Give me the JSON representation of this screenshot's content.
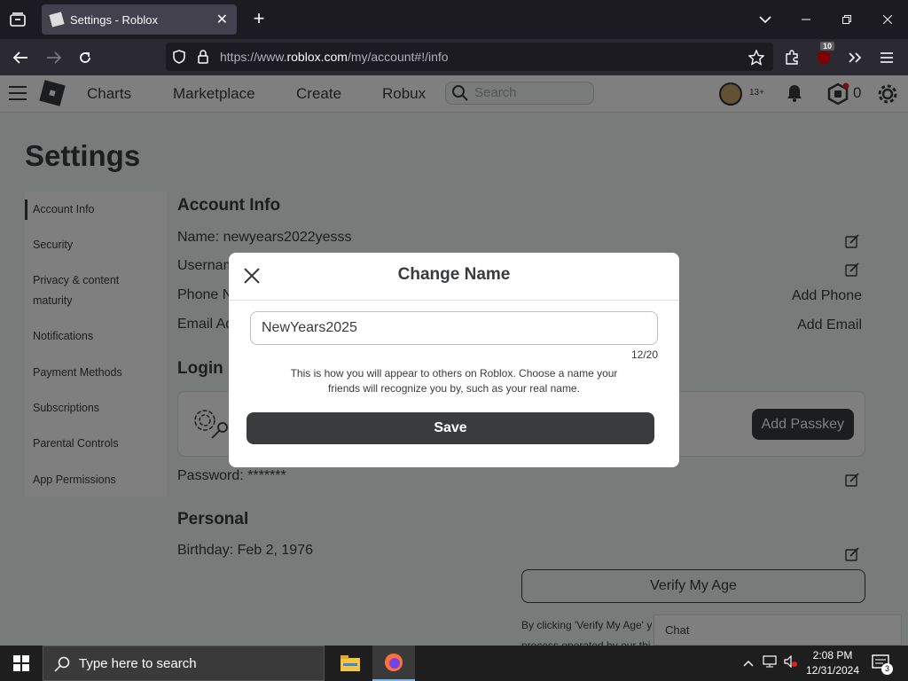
{
  "browser": {
    "tab_title": "Settings - Roblox",
    "url_prefix": "https://www.",
    "url_domain": "roblox.com",
    "url_path": "/my/account#!/info",
    "extension_badge": "10"
  },
  "header": {
    "nav": [
      "Charts",
      "Marketplace",
      "Create",
      "Robux"
    ],
    "search_placeholder": "Search",
    "age_badge": "13+",
    "robux_amount": "0"
  },
  "page": {
    "title": "Settings",
    "sidenav": [
      "Account Info",
      "Security",
      "Privacy & content",
      "maturity",
      "Notifications",
      "Payment Methods",
      "Subscriptions",
      "Parental Controls",
      "App Permissions"
    ],
    "account_info": {
      "title": "Account Info",
      "name_row": "Name: newyears2022yesss",
      "username_row": "Usernam",
      "phone_row": "Phone N",
      "email_row": "Email Ad",
      "add_phone": "Add Phone",
      "add_email": "Add Email"
    },
    "login": {
      "title": "Login",
      "add_passkey": "Add Passkey",
      "password_row": "Password: *******"
    },
    "personal": {
      "title": "Personal",
      "birthday_row": "Birthday:  Feb 2, 1976",
      "verify_button": "Verify My Age",
      "disclaimer_line1": "By clicking 'Verify My Age' y",
      "disclaimer_line2": "process operated by our thi"
    },
    "chat_label": "Chat"
  },
  "modal": {
    "title": "Change Name",
    "input_value": "NewYears2025",
    "char_count": "12/20",
    "description": "This is how you will appear to others on Roblox. Choose a name your friends will recognize you by, such as your real name.",
    "save_label": "Save"
  },
  "taskbar": {
    "search_placeholder": "Type here to search",
    "time": "2:08 PM",
    "date": "12/31/2024",
    "notification_count": "3"
  }
}
